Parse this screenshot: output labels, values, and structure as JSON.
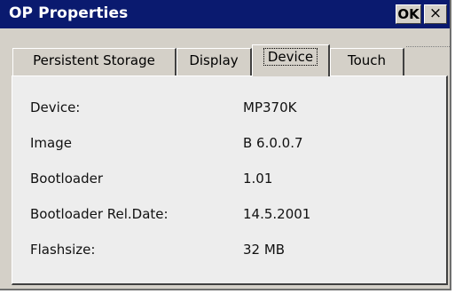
{
  "window": {
    "title": "OP Properties",
    "ok_label": "OK",
    "close_label": "×"
  },
  "tabs": [
    {
      "label": "Persistent Storage",
      "active": false
    },
    {
      "label": "Display",
      "active": false
    },
    {
      "label": "Device",
      "active": true
    },
    {
      "label": "Touch",
      "active": false
    }
  ],
  "device_info": [
    {
      "label": "Device:",
      "value": "MP370K"
    },
    {
      "label": "Image",
      "value": "B 6.0.0.7"
    },
    {
      "label": "Bootloader",
      "value": "1.01"
    },
    {
      "label": "Bootloader Rel.Date:",
      "value": "14.5.2001"
    },
    {
      "label": "Flashsize:",
      "value": "32 MB"
    }
  ],
  "colors": {
    "titlebar": "#0a1a6f",
    "panel": "#ededed",
    "chrome": "#d4d0c8"
  }
}
